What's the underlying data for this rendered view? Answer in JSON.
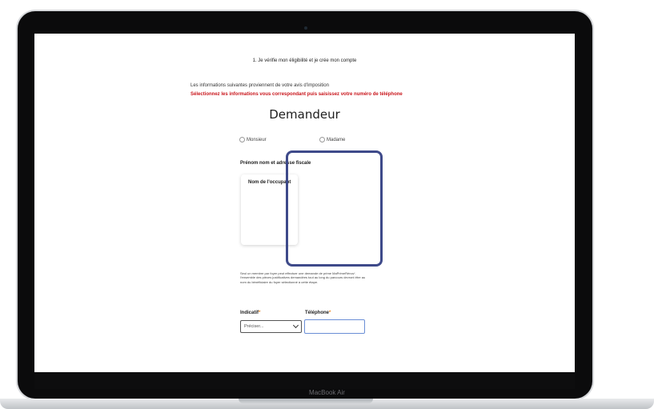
{
  "laptop": {
    "brand_label": "MacBook Air"
  },
  "page": {
    "step_title": "1. Je vérifie mon éligibilité et je crée mon compte",
    "info_text": "Les informations suivantes proviennent de votre avis d'imposition",
    "warning_text": "Sélectionnez les informations vous correspondant puis saisissez votre numéro de téléphone",
    "heading": "Demandeur",
    "civility_options": [
      "Monsieur",
      "Madame"
    ],
    "section_label": "Prénom nom et adresse fiscale",
    "occupant_card_title": "Nom de l'occupant",
    "notice": "Seul un membre par foyer peut effectuer une demande de prime MaPrimeRénov'. l'ensemble des pièces justificatives demandées tout au long du parcours devront être au nom du bénéficiaire du foyer sélectionné à cette étape.",
    "indicatif_label": "Indicatif",
    "telephone_label": "Téléphone",
    "required_mark": "*",
    "indicatif_selected": "Préciser...",
    "telephone_value": ""
  },
  "colors": {
    "warning": "#c9151b",
    "highlight": "#3e4a8a",
    "required": "#f08a24",
    "input_focus": "#6b8fd6"
  },
  "icons": {
    "select_chevron": "chevron-down-icon",
    "radio": "radio-button"
  }
}
